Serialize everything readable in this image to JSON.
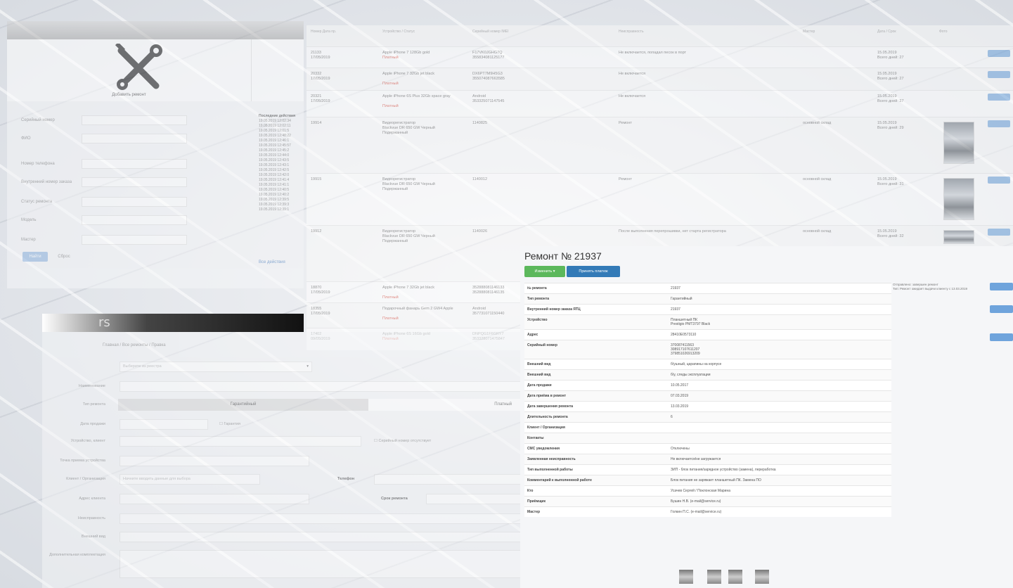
{
  "panel_add": {
    "tile_caption": "Добавить ремонт",
    "log_header": "Последние действия",
    "log_entries": [
      "19.05.2019 12:02:34",
      "19.05.2019 12:02:11",
      "19.05.2019 12:01:5",
      "19.05.2019 12:48:22",
      "19.05.2019 12:46:1",
      "19.05.2019 12:45:57",
      "19.05.2019 12:45:2",
      "19.05.2019 12:44:0",
      "19.05.2019 12:43:5",
      "19.05.2019 12:43:1",
      "19.05.2019 12:42:5",
      "19.05.2019 12:42:0",
      "19.05.2019 12:41:4",
      "19.05.2019 12:41:1",
      "19.05.2019 12:40:5",
      "19.05.2019 12:40:2",
      "19.05.2019 12:39:5",
      "19.05.2019 12:39:3",
      "19.05.2019 12:39:1"
    ],
    "log_more": "Все действия",
    "save": "Найти",
    "reset": "Сброс"
  },
  "repair_table": {
    "headers": [
      "Номер\nДата пр.",
      "Устройство / Статус",
      "Серийный номер\nIMEI",
      "Неисправность",
      "Мастер",
      "Дата / Срок",
      "Фото"
    ],
    "rows": [
      {
        "num": "21133\n17/05/2019",
        "device": "Apple iPhone 7 128Gb gold",
        "status": "Платный",
        "serial": "F17VK0JGHG7Q\n355834081125177",
        "issue": "Не включается, попадал песок в порт",
        "master": "",
        "date": "15.05.2019\nВсего дней: 27"
      },
      {
        "num": "20332\n17/05/2019",
        "device": "Apple iPhone 7 32Gb jet black",
        "status": "Платный",
        "serial": "DX6PT7M9H5G3\n355074087663585",
        "issue": "Не включается",
        "master": "",
        "date": "15.05.2019\nВсего дней: 27"
      },
      {
        "num": "20321\n17/05/2019",
        "device": "Apple iPhone 6S Plus 32Gb space gray",
        "status": "Платный",
        "serial": "Android\n353325071147545",
        "issue": "Не включается",
        "master": "",
        "date": "15.05.2019\nВсего дней: 27"
      },
      {
        "num": "19914",
        "device": "Видеорегистратор\nBlackvue DR 650 GW Черный\nПодержанный",
        "status": "",
        "serial": "1140825",
        "issue": "Ремонт",
        "master": "основной склад",
        "date": "15.05.2019\nВсего дней: 29"
      },
      {
        "num": "19915",
        "device": "Видеорегистратор\nBlackvue DR 650 GW Черный\nПодержанный",
        "status": "",
        "serial": "1140012",
        "issue": "Ремонт",
        "master": "основной склад",
        "date": "15.05.2019\nВсего дней: 31"
      },
      {
        "num": "19912",
        "device": "Видеорегистратор\nBlackvue DR 650 GW Черный\nПодержанный",
        "status": "",
        "serial": "1140026",
        "issue": "После выполнения перепрошивки, нет старта регистратора",
        "master": "основной склад",
        "date": "15.05.2019\nВсего дней: 32"
      },
      {
        "num": "18870\n17/05/2019",
        "device": "Apple iPhone 7 32Gb jet black",
        "status": "Платный",
        "serial": "352888081146133\n352888081146135",
        "issue": "",
        "master": "",
        "date": ""
      },
      {
        "num": "18355\n17/05/2019",
        "device": "Подарочный фанарь Gem 2 GW4 Apple",
        "status": "Платный",
        "serial": "Android\n357731071150440",
        "issue": "",
        "master": "",
        "date": ""
      },
      {
        "num": "17402\n09/05/2019",
        "device": "Apple iPhone 6S 16Gb gold",
        "status": "Платный",
        "serial": "DNPQG1F6GRY7\n353328071475847",
        "issue": "",
        "master": "",
        "date": ""
      }
    ]
  },
  "form_panel": {
    "breadcrumb": "Главная / Все ремонты / Правка",
    "select_placeholder": "Выберите из реестра",
    "labels": [
      "Наименование",
      "Тип ремонта",
      "Дата продажи",
      "Устройство, клиент",
      "Точка приема устройства",
      "Клиент / Организация",
      "Адрес клиента",
      "Неисправность",
      "Внешний вид",
      "Дополнительная комплектация"
    ],
    "seg_active": "Гарантийный",
    "seg_inactive": "Платный",
    "guarantee_label": "Гарантия",
    "missing_imei": "Серийный номер отсутствует",
    "client_placeholder": "Начните вводить данные для выбора",
    "phone_label": "Телефон",
    "deadline_label": "Срок ремонта"
  },
  "detail": {
    "title": "Ремонт № 21937",
    "btn_green": "Изменить ▾",
    "btn_blue": "Принять платеж",
    "rows": [
      {
        "k": "№ ремонта",
        "v": "21937"
      },
      {
        "k": "Тип ремонта",
        "v": "Гарантийный"
      },
      {
        "k": "Внутренний номер заказа ЯТЦ",
        "v": "21937"
      },
      {
        "k": "Устройство",
        "v": "Планшетный ПК\nPrestigio PMT3797 Black"
      },
      {
        "k": "Адрес",
        "v": "28410E0573110"
      },
      {
        "k": "Серийный номер",
        "v": "370087411563\n308917107611207\n379851026913209"
      },
      {
        "k": "Внешний вид",
        "v": "б/ушный, царапины на корпусе"
      },
      {
        "k": "Внешний вид",
        "v": "б/у, следы эксплуатации"
      },
      {
        "k": "Дата продажи",
        "v": "10.05.2017"
      },
      {
        "k": "Дата приёма в ремонт",
        "v": "07.03.2019"
      },
      {
        "k": "Дата завершения ремонта",
        "v": "13.03.2019"
      },
      {
        "k": "Длительность ремонта",
        "v": "6"
      },
      {
        "k": "Клиент / Организация",
        "v": ""
      },
      {
        "k": "Контакты",
        "v": ""
      },
      {
        "k": "СМС уведомления",
        "v": "Отключены"
      },
      {
        "k": "Заявленная неисправность",
        "v": "Не включается/не загружается"
      },
      {
        "k": "Тип выполненной работы",
        "v": "ЗИП - блок питания/зарядное устройство (замена), переработка"
      },
      {
        "k": "Комментарий к выполненной работе",
        "v": "Блок питания не заряжает планшетный ПК. Замена ПО"
      },
      {
        "k": "Кто",
        "v": "Усачев Сергей / Поклонская Марина"
      },
      {
        "k": "Приёмщик",
        "v": "Бушин Н.В. (e-mail@service.ru)"
      },
      {
        "k": "Мастер",
        "v": "Голкин П.С. (e-mail@service.ru)"
      }
    ],
    "side_l1": "Отправлено: завершен ремонт",
    "side_l2": "Тип: Ремонт ожидает выдачи клиенту с 13.03.2019"
  },
  "colors": {
    "accent_blue": "#3b73b9",
    "button_blue": "#337ab7",
    "button_green": "#5cb85c",
    "status_red": "#d43a2a"
  },
  "icons": [
    "tools-icon",
    "dropdown-caret-icon",
    "checkbox-icon",
    "photo-thumbnail-icon"
  ]
}
